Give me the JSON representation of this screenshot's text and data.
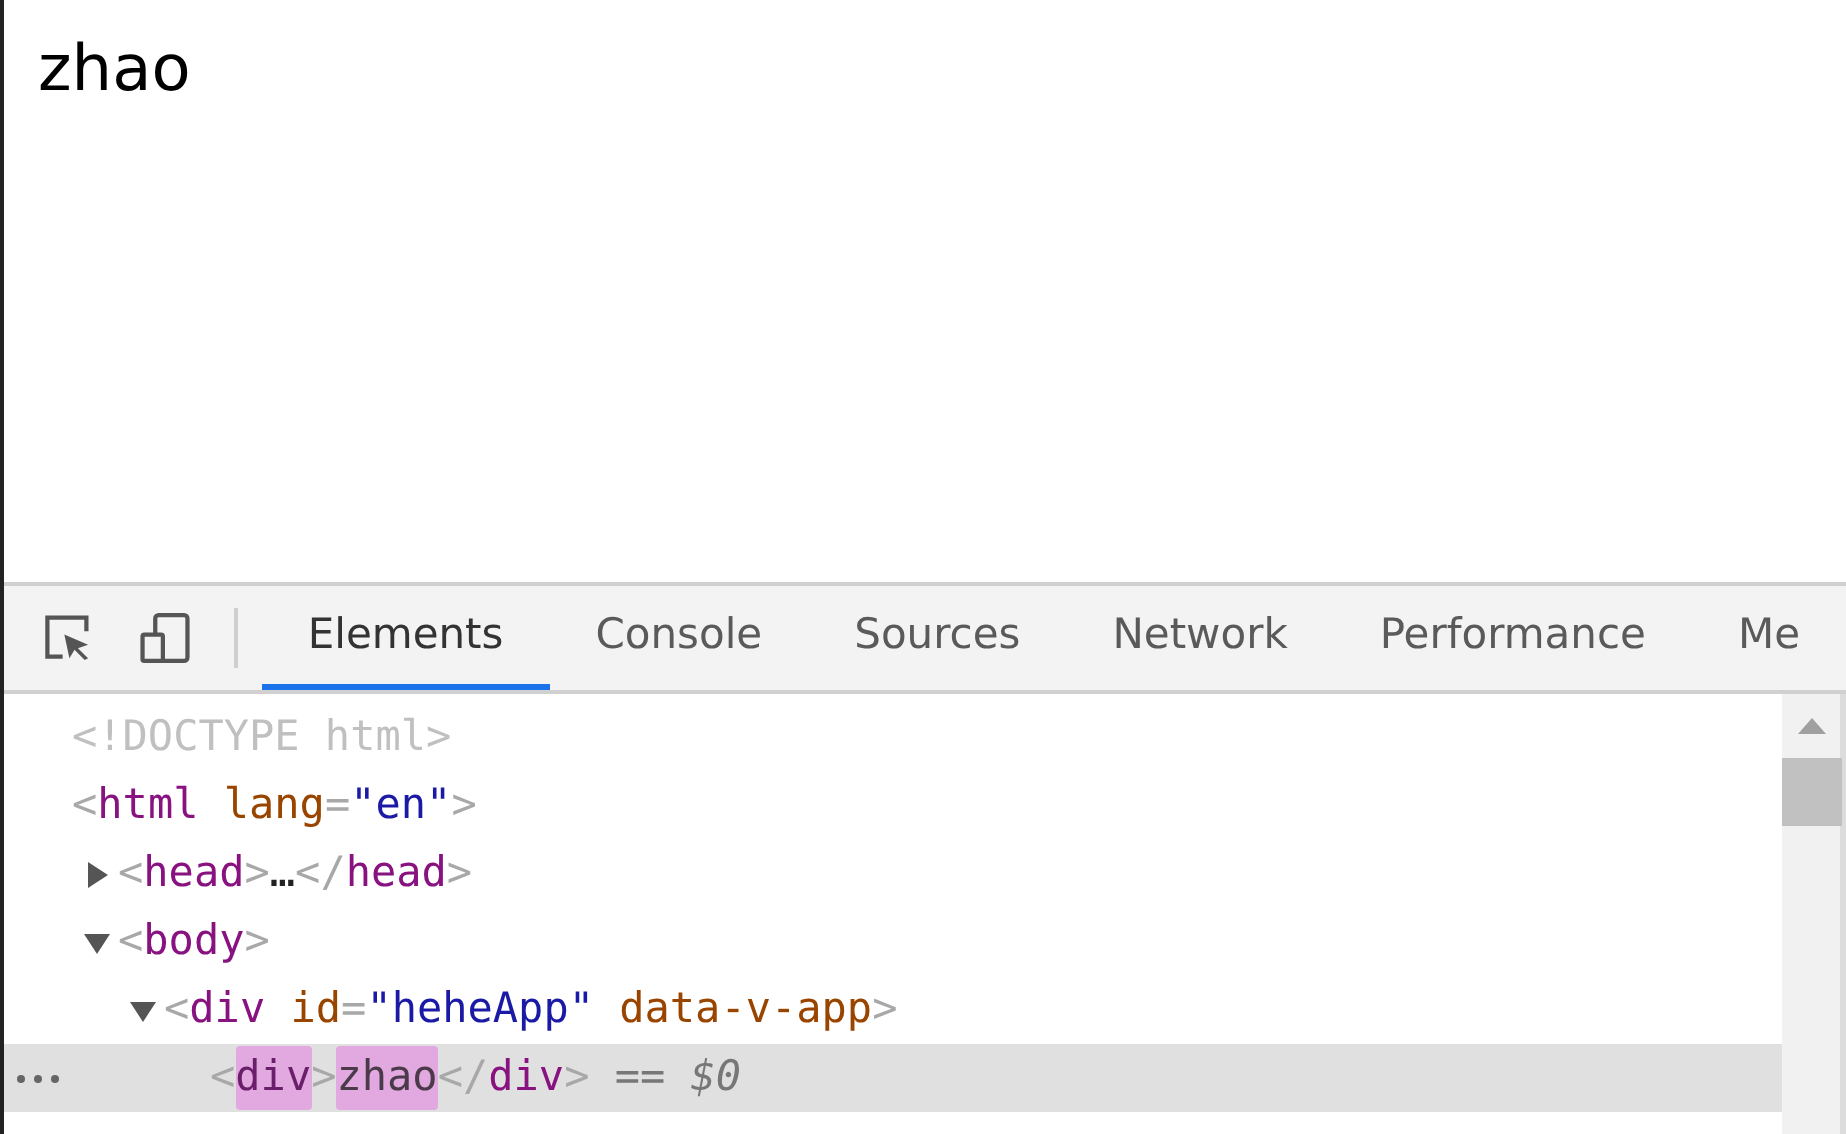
{
  "page": {
    "text": "zhao"
  },
  "devtools": {
    "tabs": [
      {
        "label": "Elements",
        "selected": true
      },
      {
        "label": "Console",
        "selected": false
      },
      {
        "label": "Sources",
        "selected": false
      },
      {
        "label": "Network",
        "selected": false
      },
      {
        "label": "Performance",
        "selected": false
      },
      {
        "label": "Me",
        "selected": false
      }
    ],
    "tree": [
      {
        "selected": false,
        "tokens": [
          {
            "kind": "doctype",
            "text": "<!DOCTYPE html>"
          }
        ]
      },
      {
        "selected": false,
        "tokens": [
          {
            "kind": "punct",
            "text": "<"
          },
          {
            "kind": "tag",
            "text": "html"
          },
          {
            "kind": "attr",
            "text": " lang"
          },
          {
            "kind": "punct",
            "text": "="
          },
          {
            "kind": "value",
            "text": "\"en\""
          },
          {
            "kind": "punct",
            "text": ">"
          }
        ],
        "children": [
          {
            "selected": false,
            "expanded": false,
            "tokens": [
              {
                "kind": "punct",
                "text": "<"
              },
              {
                "kind": "tag",
                "text": "head"
              },
              {
                "kind": "punct",
                "text": ">"
              },
              {
                "kind": "text",
                "text": "…"
              },
              {
                "kind": "punct",
                "text": "</"
              },
              {
                "kind": "tag",
                "text": "head"
              },
              {
                "kind": "punct",
                "text": ">"
              }
            ]
          },
          {
            "selected": false,
            "expanded": true,
            "tokens": [
              {
                "kind": "punct",
                "text": "<"
              },
              {
                "kind": "tag",
                "text": "body"
              },
              {
                "kind": "punct",
                "text": ">"
              }
            ],
            "children": [
              {
                "selected": false,
                "expanded": true,
                "tokens": [
                  {
                    "kind": "punct",
                    "text": "<"
                  },
                  {
                    "kind": "tag",
                    "text": "div"
                  },
                  {
                    "kind": "attr",
                    "text": " id"
                  },
                  {
                    "kind": "punct",
                    "text": "="
                  },
                  {
                    "kind": "value",
                    "text": "\"heheApp\""
                  },
                  {
                    "kind": "attr",
                    "text": " data-v-app"
                  },
                  {
                    "kind": "punct",
                    "text": ">"
                  }
                ],
                "children": [
                  {
                    "selected": true,
                    "tokens": [
                      {
                        "kind": "punct",
                        "text": "<",
                        "highlighted": false
                      },
                      {
                        "kind": "tag",
                        "text": "div",
                        "highlighted": true
                      },
                      {
                        "kind": "punct",
                        "text": ">",
                        "highlighted": false
                      },
                      {
                        "kind": "text",
                        "text": "zhao",
                        "highlighted": true
                      },
                      {
                        "kind": "punct",
                        "text": "</",
                        "highlighted": false
                      },
                      {
                        "kind": "tag",
                        "text": "div",
                        "highlighted": false
                      },
                      {
                        "kind": "punct",
                        "text": ">",
                        "highlighted": false
                      },
                      {
                        "kind": "ref",
                        "text": " == $0",
                        "highlighted": false
                      }
                    ]
                  }
                ]
              }
            ]
          }
        ]
      }
    ]
  }
}
